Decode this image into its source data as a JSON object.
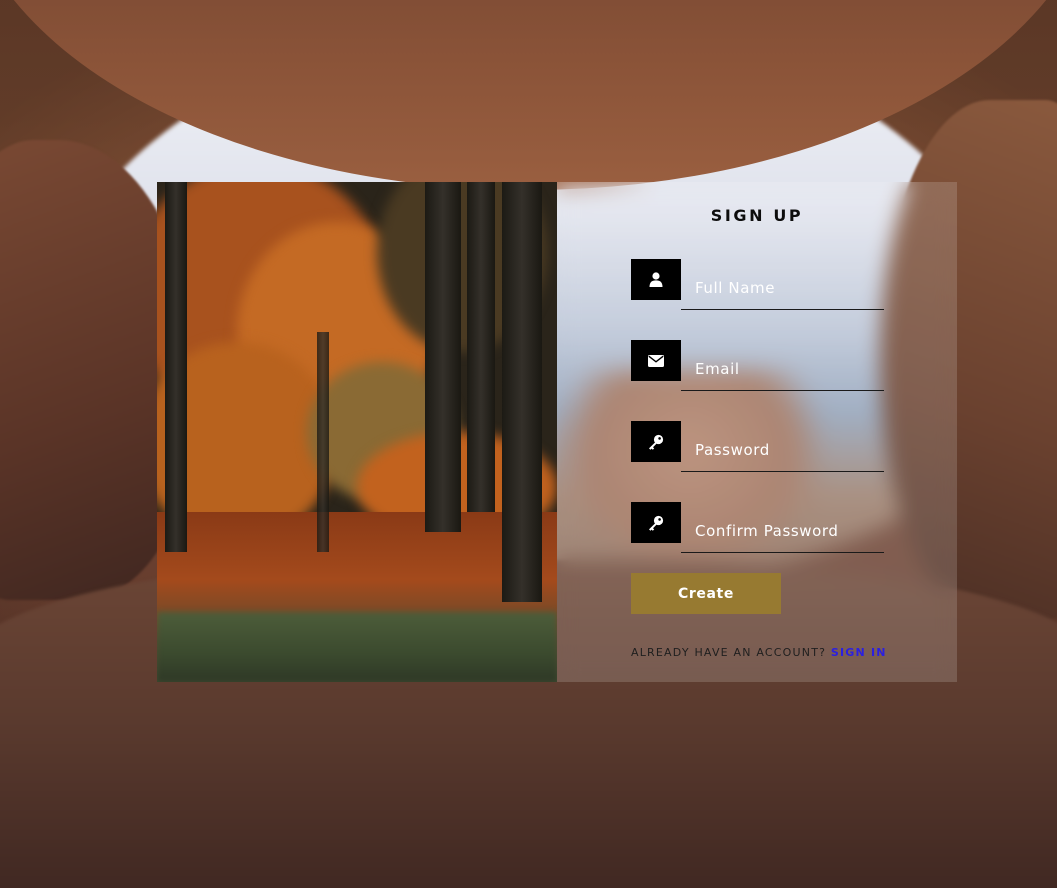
{
  "form": {
    "title": "SIGN UP",
    "fields": [
      {
        "name": "full-name",
        "placeholder": "Full Name",
        "icon": "user-icon"
      },
      {
        "name": "email",
        "placeholder": "Email",
        "icon": "envelope-icon"
      },
      {
        "name": "password",
        "placeholder": "Password",
        "icon": "key-icon"
      },
      {
        "name": "confirm-password",
        "placeholder": "Confirm Password",
        "icon": "key-icon"
      }
    ],
    "create_label": "Create",
    "account_prompt": "ALREADY HAVE AN ACCOUNT?",
    "signin_label": "SIGN IN"
  },
  "colors": {
    "button": "#977a31",
    "link": "#2b1fe0",
    "icon_box": "#000000"
  }
}
